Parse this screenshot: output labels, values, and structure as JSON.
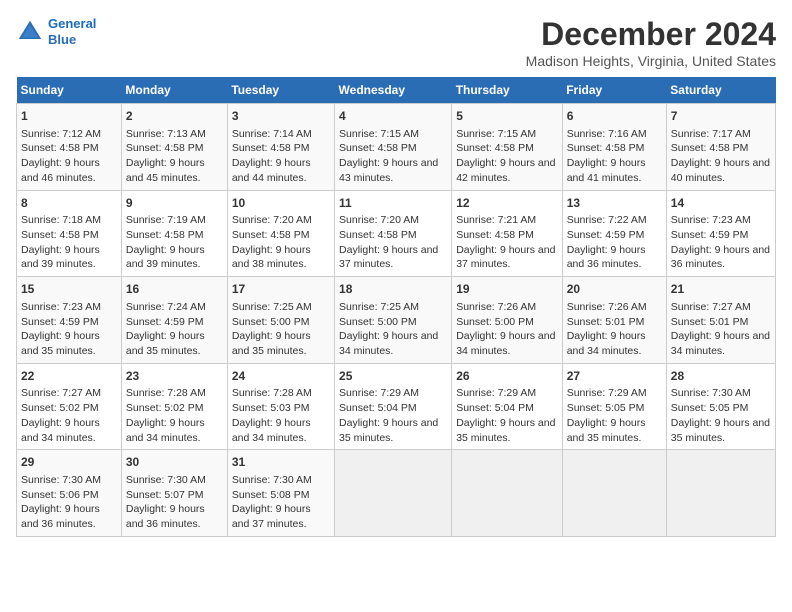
{
  "header": {
    "logo_line1": "General",
    "logo_line2": "Blue",
    "title": "December 2024",
    "subtitle": "Madison Heights, Virginia, United States"
  },
  "days_of_week": [
    "Sunday",
    "Monday",
    "Tuesday",
    "Wednesday",
    "Thursday",
    "Friday",
    "Saturday"
  ],
  "weeks": [
    [
      {
        "day": "1",
        "data": "Sunrise: 7:12 AM\nSunset: 4:58 PM\nDaylight: 9 hours and 46 minutes."
      },
      {
        "day": "2",
        "data": "Sunrise: 7:13 AM\nSunset: 4:58 PM\nDaylight: 9 hours and 45 minutes."
      },
      {
        "day": "3",
        "data": "Sunrise: 7:14 AM\nSunset: 4:58 PM\nDaylight: 9 hours and 44 minutes."
      },
      {
        "day": "4",
        "data": "Sunrise: 7:15 AM\nSunset: 4:58 PM\nDaylight: 9 hours and 43 minutes."
      },
      {
        "day": "5",
        "data": "Sunrise: 7:15 AM\nSunset: 4:58 PM\nDaylight: 9 hours and 42 minutes."
      },
      {
        "day": "6",
        "data": "Sunrise: 7:16 AM\nSunset: 4:58 PM\nDaylight: 9 hours and 41 minutes."
      },
      {
        "day": "7",
        "data": "Sunrise: 7:17 AM\nSunset: 4:58 PM\nDaylight: 9 hours and 40 minutes."
      }
    ],
    [
      {
        "day": "8",
        "data": "Sunrise: 7:18 AM\nSunset: 4:58 PM\nDaylight: 9 hours and 39 minutes."
      },
      {
        "day": "9",
        "data": "Sunrise: 7:19 AM\nSunset: 4:58 PM\nDaylight: 9 hours and 39 minutes."
      },
      {
        "day": "10",
        "data": "Sunrise: 7:20 AM\nSunset: 4:58 PM\nDaylight: 9 hours and 38 minutes."
      },
      {
        "day": "11",
        "data": "Sunrise: 7:20 AM\nSunset: 4:58 PM\nDaylight: 9 hours and 37 minutes."
      },
      {
        "day": "12",
        "data": "Sunrise: 7:21 AM\nSunset: 4:58 PM\nDaylight: 9 hours and 37 minutes."
      },
      {
        "day": "13",
        "data": "Sunrise: 7:22 AM\nSunset: 4:59 PM\nDaylight: 9 hours and 36 minutes."
      },
      {
        "day": "14",
        "data": "Sunrise: 7:23 AM\nSunset: 4:59 PM\nDaylight: 9 hours and 36 minutes."
      }
    ],
    [
      {
        "day": "15",
        "data": "Sunrise: 7:23 AM\nSunset: 4:59 PM\nDaylight: 9 hours and 35 minutes."
      },
      {
        "day": "16",
        "data": "Sunrise: 7:24 AM\nSunset: 4:59 PM\nDaylight: 9 hours and 35 minutes."
      },
      {
        "day": "17",
        "data": "Sunrise: 7:25 AM\nSunset: 5:00 PM\nDaylight: 9 hours and 35 minutes."
      },
      {
        "day": "18",
        "data": "Sunrise: 7:25 AM\nSunset: 5:00 PM\nDaylight: 9 hours and 34 minutes."
      },
      {
        "day": "19",
        "data": "Sunrise: 7:26 AM\nSunset: 5:00 PM\nDaylight: 9 hours and 34 minutes."
      },
      {
        "day": "20",
        "data": "Sunrise: 7:26 AM\nSunset: 5:01 PM\nDaylight: 9 hours and 34 minutes."
      },
      {
        "day": "21",
        "data": "Sunrise: 7:27 AM\nSunset: 5:01 PM\nDaylight: 9 hours and 34 minutes."
      }
    ],
    [
      {
        "day": "22",
        "data": "Sunrise: 7:27 AM\nSunset: 5:02 PM\nDaylight: 9 hours and 34 minutes."
      },
      {
        "day": "23",
        "data": "Sunrise: 7:28 AM\nSunset: 5:02 PM\nDaylight: 9 hours and 34 minutes."
      },
      {
        "day": "24",
        "data": "Sunrise: 7:28 AM\nSunset: 5:03 PM\nDaylight: 9 hours and 34 minutes."
      },
      {
        "day": "25",
        "data": "Sunrise: 7:29 AM\nSunset: 5:04 PM\nDaylight: 9 hours and 35 minutes."
      },
      {
        "day": "26",
        "data": "Sunrise: 7:29 AM\nSunset: 5:04 PM\nDaylight: 9 hours and 35 minutes."
      },
      {
        "day": "27",
        "data": "Sunrise: 7:29 AM\nSunset: 5:05 PM\nDaylight: 9 hours and 35 minutes."
      },
      {
        "day": "28",
        "data": "Sunrise: 7:30 AM\nSunset: 5:05 PM\nDaylight: 9 hours and 35 minutes."
      }
    ],
    [
      {
        "day": "29",
        "data": "Sunrise: 7:30 AM\nSunset: 5:06 PM\nDaylight: 9 hours and 36 minutes."
      },
      {
        "day": "30",
        "data": "Sunrise: 7:30 AM\nSunset: 5:07 PM\nDaylight: 9 hours and 36 minutes."
      },
      {
        "day": "31",
        "data": "Sunrise: 7:30 AM\nSunset: 5:08 PM\nDaylight: 9 hours and 37 minutes."
      },
      {
        "day": "",
        "data": ""
      },
      {
        "day": "",
        "data": ""
      },
      {
        "day": "",
        "data": ""
      },
      {
        "day": "",
        "data": ""
      }
    ]
  ]
}
